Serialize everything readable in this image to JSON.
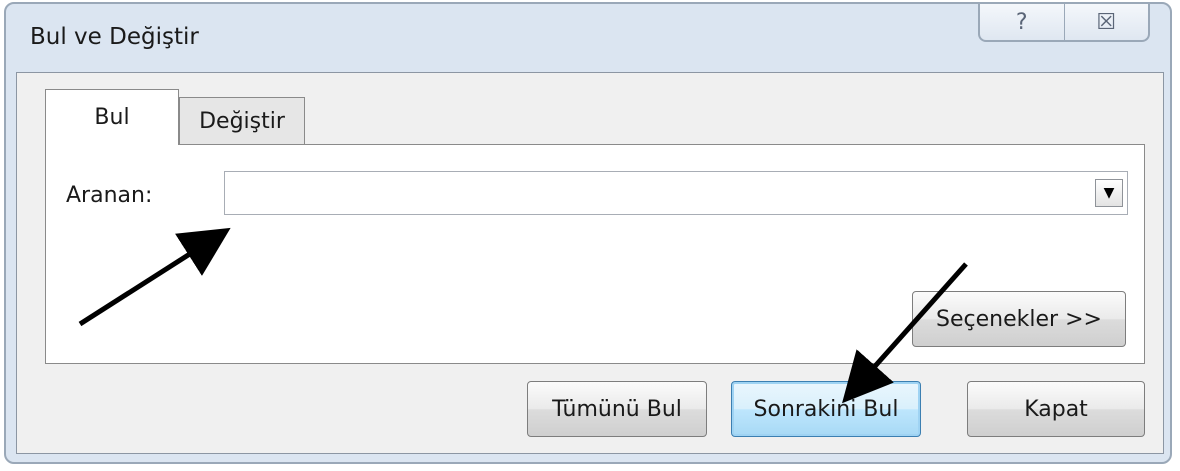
{
  "window": {
    "title": "Bul ve Değiştir",
    "help_glyph": "?",
    "close_glyph": "☒"
  },
  "tabs": [
    {
      "label": "Bul",
      "active": true
    },
    {
      "label": "Değiştir",
      "active": false
    }
  ],
  "find": {
    "label": "Aranan:",
    "value": "",
    "dropdown_glyph": "▼"
  },
  "buttons": {
    "options": "Seçenekler >>",
    "find_all": "Tümünü Bul",
    "find_next": "Sonrakini Bul",
    "close": "Kapat"
  },
  "colors": {
    "frame": "#dbe5f1",
    "client": "#f0f0f0",
    "focus_button": "#bee6fd"
  }
}
